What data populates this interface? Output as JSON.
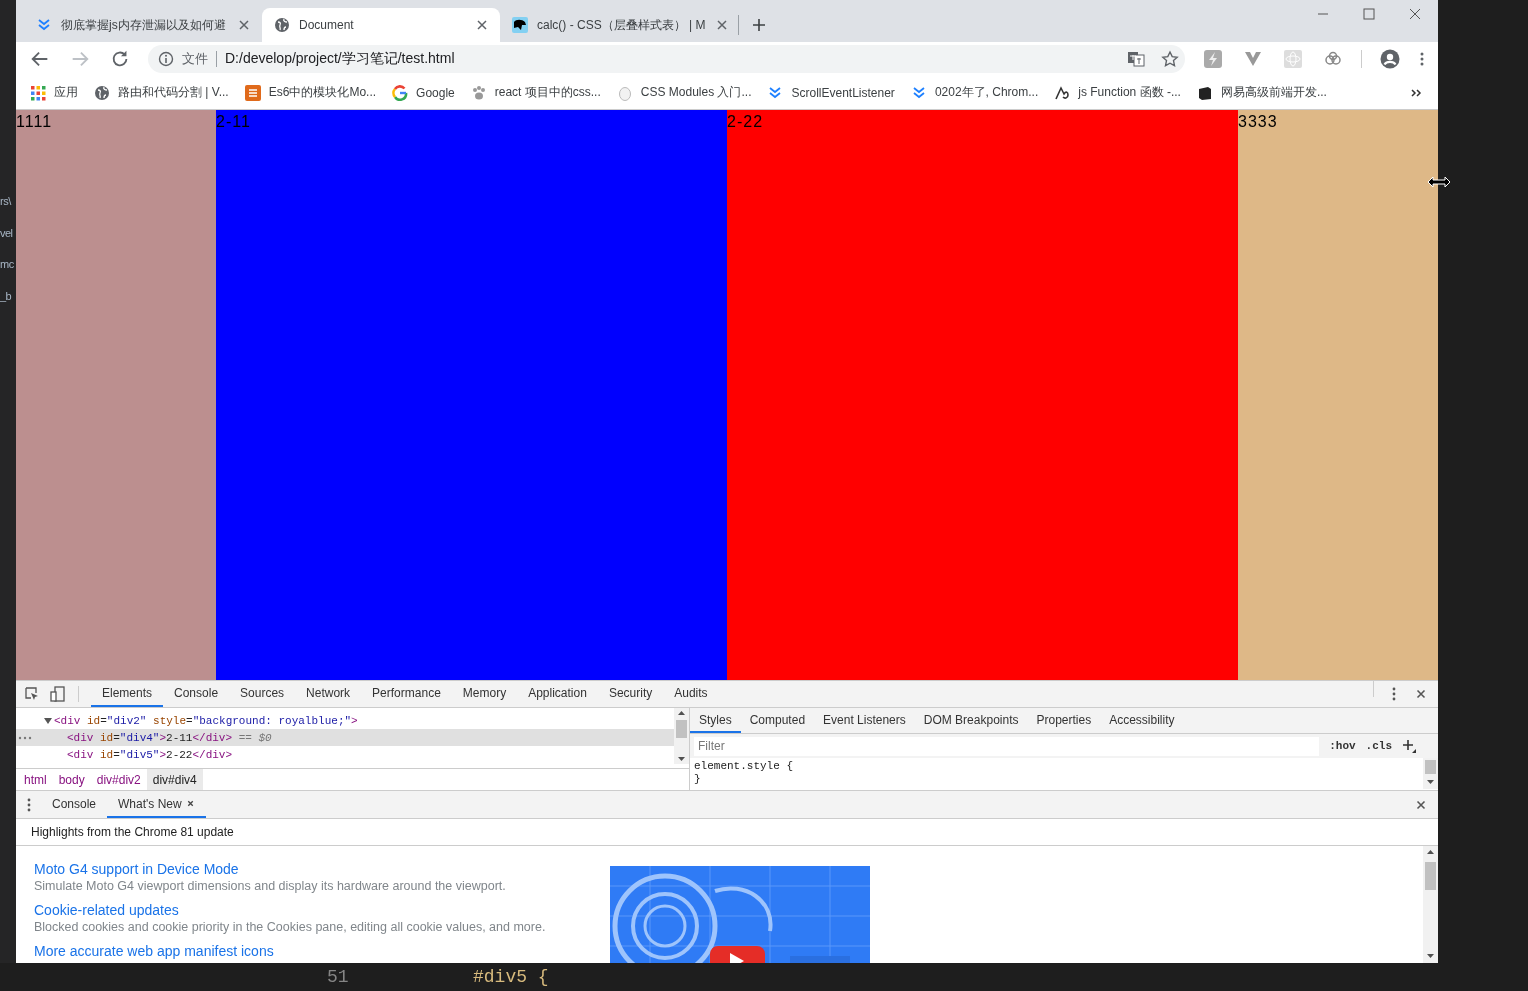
{
  "editor": {
    "side_texts": [
      "rs\\",
      "vel",
      "mc",
      "_b"
    ],
    "line_number": "51",
    "code_line": "#div5 {"
  },
  "browser": {
    "tabs": [
      {
        "title": "彻底掌握js内存泄漏以及如何避",
        "kind": "chevrons",
        "selected": false
      },
      {
        "title": "Document",
        "kind": "globe",
        "selected": true
      },
      {
        "title": "calc() - CSS（层叠样式表） | M",
        "kind": "dino",
        "selected": false
      }
    ],
    "address": {
      "label": "文件",
      "url": "D:/develop/project/学习笔记/test.html"
    },
    "bookmarks": [
      {
        "label": "应用",
        "kind": "apps"
      },
      {
        "label": "路由和代码分割 | V...",
        "kind": "globe"
      },
      {
        "label": "Es6中的模块化Mo...",
        "kind": "square"
      },
      {
        "label": "Google",
        "kind": "g"
      },
      {
        "label": "react 项目中的css...",
        "kind": "paw"
      },
      {
        "label": "CSS Modules 入门...",
        "kind": "egg"
      },
      {
        "label": "ScrollEventListener",
        "kind": "chevrons"
      },
      {
        "label": "0202年了, Chrom...",
        "kind": "chevrons"
      },
      {
        "label": "js Function 函数 -...",
        "kind": "glyph"
      },
      {
        "label": "网易高级前端开发...",
        "kind": "book"
      }
    ]
  },
  "page": {
    "columns": [
      {
        "text": "1111",
        "color": "#bc8f8f"
      },
      {
        "text": "2-11",
        "color": "#0000ff"
      },
      {
        "text": "2-22",
        "color": "#ff0000"
      },
      {
        "text": "3333",
        "color": "#deb887"
      }
    ]
  },
  "devtools": {
    "tabs": [
      {
        "label": "Elements",
        "selected": true
      },
      {
        "label": "Console",
        "selected": false
      },
      {
        "label": "Sources",
        "selected": false
      },
      {
        "label": "Network",
        "selected": false
      },
      {
        "label": "Performance",
        "selected": false
      },
      {
        "label": "Memory",
        "selected": false
      },
      {
        "label": "Application",
        "selected": false
      },
      {
        "label": "Security",
        "selected": false
      },
      {
        "label": "Audits",
        "selected": false
      }
    ],
    "dom_tree": [
      {
        "expanded": true,
        "selected": false,
        "tokens": [
          {
            "text": "<div",
            "kind": "tag"
          },
          {
            "text": " id",
            "kind": "attr"
          },
          {
            "text": "=",
            "kind": "plain"
          },
          {
            "text": "\"div2\"",
            "kind": "value"
          },
          {
            "text": " style",
            "kind": "attr"
          },
          {
            "text": "=",
            "kind": "plain"
          },
          {
            "text": "\"background: royalblue;\"",
            "kind": "value"
          },
          {
            "text": ">",
            "kind": "tag"
          }
        ],
        "children": [
          {
            "selected": true,
            "tokens": [
              {
                "text": "<div",
                "kind": "tag"
              },
              {
                "text": " id",
                "kind": "attr"
              },
              {
                "text": "=",
                "kind": "plain"
              },
              {
                "text": "\"div4\"",
                "kind": "value"
              },
              {
                "text": ">",
                "kind": "tag"
              },
              {
                "text": "2-11",
                "kind": "plain"
              },
              {
                "text": "</div>",
                "kind": "tag"
              },
              {
                "text": " == ",
                "kind": "hint"
              },
              {
                "text": "$0",
                "kind": "var"
              }
            ]
          },
          {
            "selected": false,
            "tokens": [
              {
                "text": "<div",
                "kind": "tag"
              },
              {
                "text": " id",
                "kind": "attr"
              },
              {
                "text": "=",
                "kind": "plain"
              },
              {
                "text": "\"div5\"",
                "kind": "value"
              },
              {
                "text": ">",
                "kind": "tag"
              },
              {
                "text": "2-22",
                "kind": "plain"
              },
              {
                "text": "</div>",
                "kind": "tag"
              }
            ]
          }
        ]
      }
    ],
    "breadcrumbs": [
      {
        "label": "html",
        "selected": false
      },
      {
        "label": "body",
        "selected": false
      },
      {
        "label": "div#div2",
        "selected": false
      },
      {
        "label": "div#div4",
        "selected": true
      }
    ],
    "style_tabs": [
      {
        "label": "Styles",
        "selected": true
      },
      {
        "label": "Computed",
        "selected": false
      },
      {
        "label": "Event Listeners",
        "selected": false
      },
      {
        "label": "DOM Breakpoints",
        "selected": false
      },
      {
        "label": "Properties",
        "selected": false
      },
      {
        "label": "Accessibility",
        "selected": false
      }
    ],
    "filter": {
      "placeholder": "Filter"
    },
    "style_buttons": [
      ":hov",
      ".cls"
    ],
    "style_rules": [
      "element.style {",
      "}"
    ]
  },
  "drawer": {
    "tabs": [
      {
        "label": "Console",
        "selected": false,
        "closable": false
      },
      {
        "label": "What's New",
        "selected": true,
        "closable": true
      }
    ],
    "heading": "Highlights from the Chrome 81 update",
    "items": [
      {
        "title": "Moto G4 support in Device Mode",
        "description": "Simulate Moto G4 viewport dimensions and display its hardware around the viewport."
      },
      {
        "title": "Cookie-related updates",
        "description": "Blocked cookies and cookie priority in the Cookies pane, editing all cookie values, and more."
      },
      {
        "title": "More accurate web app manifest icons"
      }
    ]
  }
}
